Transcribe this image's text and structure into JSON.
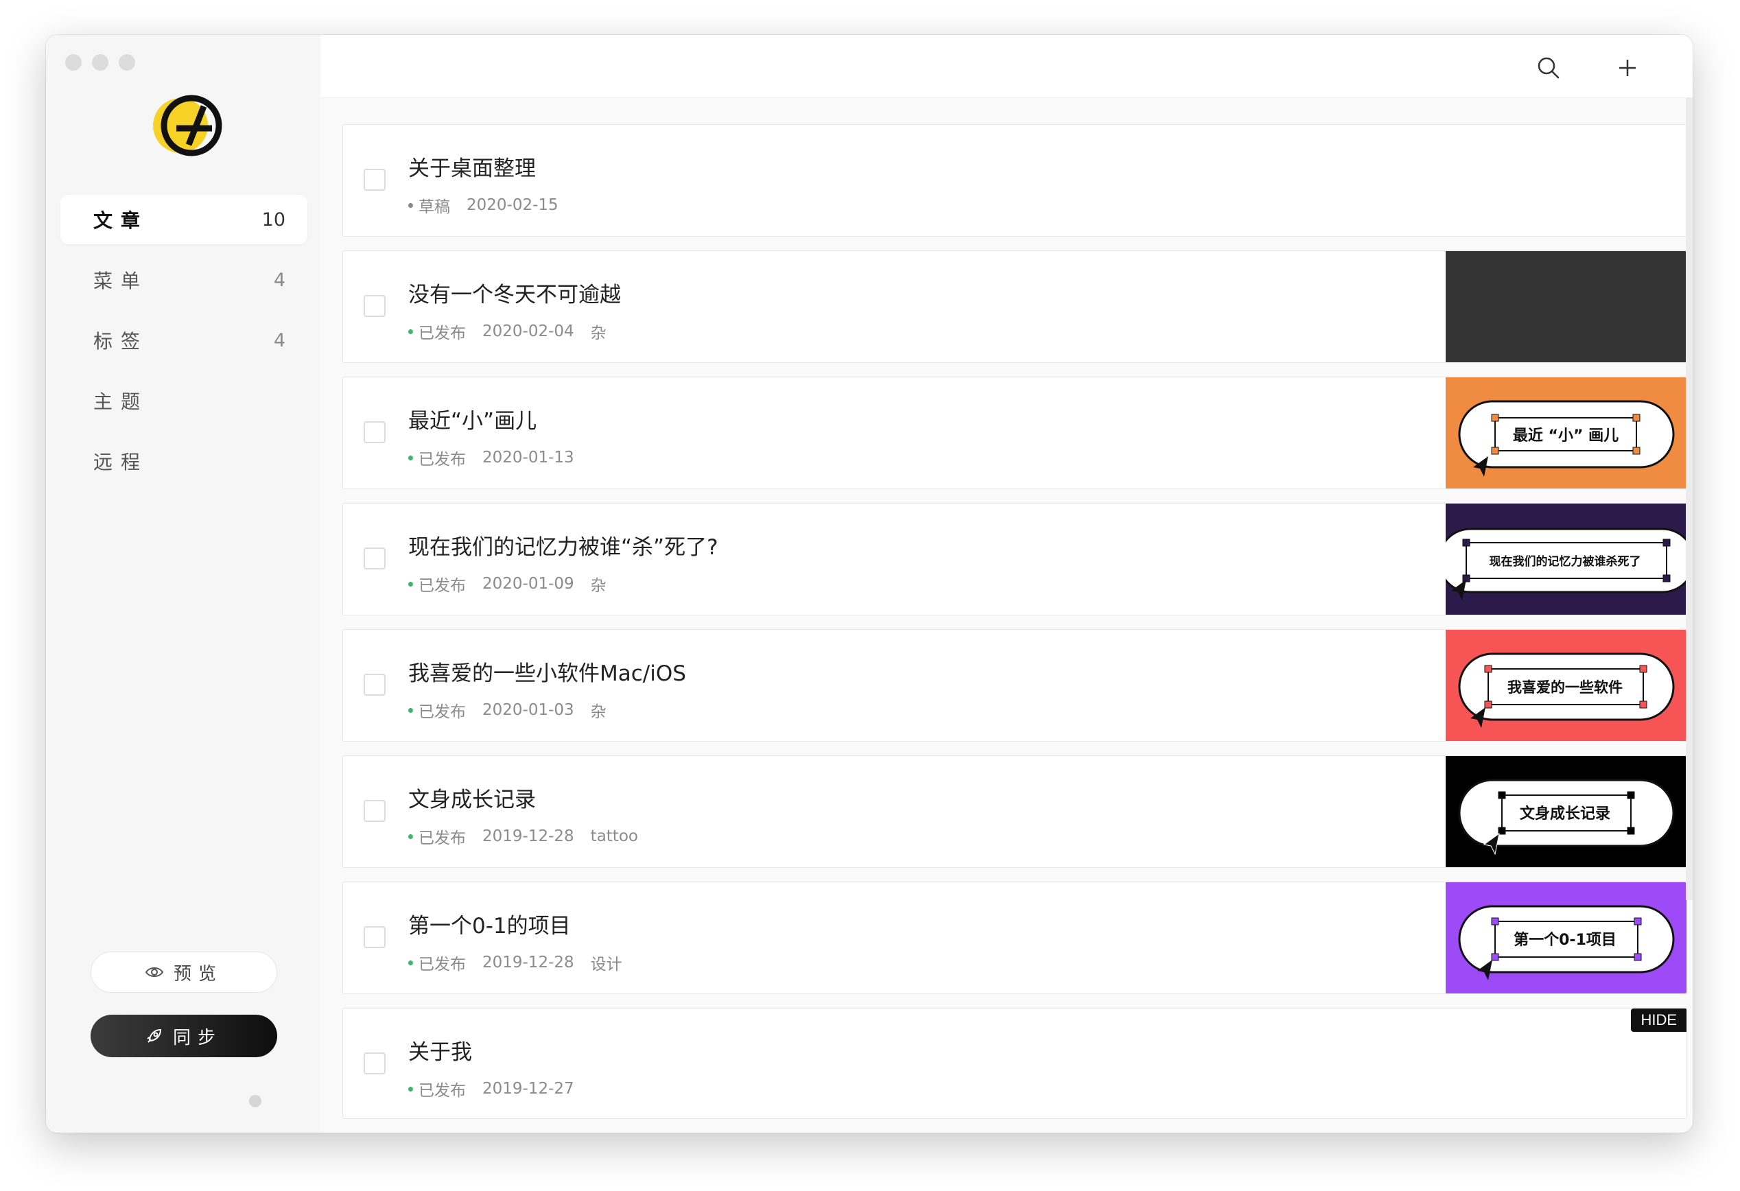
{
  "sidebar": {
    "nav": [
      {
        "label": "文章",
        "count": "10"
      },
      {
        "label": "菜单",
        "count": "4"
      },
      {
        "label": "标签",
        "count": "4"
      },
      {
        "label": "主题",
        "count": ""
      },
      {
        "label": "远程",
        "count": ""
      }
    ],
    "preview_label": "预览",
    "sync_label": "同步"
  },
  "colors": {
    "logo_yellow": "#F7D226",
    "published_dot": "#3CB371",
    "draft_dot": "#888888",
    "thumb_dark": "#343434",
    "thumb_orange": "#EF8C41",
    "thumb_purple_dark": "#2B1A4A",
    "thumb_red": "#F75555",
    "thumb_black": "#000000",
    "thumb_violet": "#9C4BF7"
  },
  "posts": [
    {
      "title": "关于桌面整理",
      "status": "草稿",
      "date": "2020-02-15",
      "tag": "",
      "thumb": ""
    },
    {
      "title": "没有一个冬天不可逾越",
      "status": "已发布",
      "date": "2020-02-04",
      "tag": "杂",
      "thumb": "dark"
    },
    {
      "title": "最近“小”画儿",
      "status": "已发布",
      "date": "2020-01-13",
      "tag": "",
      "thumb": "orange",
      "thumb_text": "最近 “小” 画儿"
    },
    {
      "title": "现在我们的记忆力被谁“杀”死了?",
      "status": "已发布",
      "date": "2020-01-09",
      "tag": "杂",
      "thumb": "purple-dark",
      "thumb_text": "现在我们的记忆力被谁杀死了"
    },
    {
      "title": "我喜爱的一些小软件Mac/iOS",
      "status": "已发布",
      "date": "2020-01-03",
      "tag": "杂",
      "thumb": "red",
      "thumb_text": "我喜爱的一些软件"
    },
    {
      "title": "文身成长记录",
      "status": "已发布",
      "date": "2019-12-28",
      "tag": "tattoo",
      "thumb": "black",
      "thumb_text": "文身成长记录"
    },
    {
      "title": "第一个0-1的项目",
      "status": "已发布",
      "date": "2019-12-28",
      "tag": "设计",
      "thumb": "violet",
      "thumb_text": "第一个0-1项目"
    },
    {
      "title": "关于我",
      "status": "已发布",
      "date": "2019-12-27",
      "tag": "",
      "thumb": "",
      "badge": "HIDE"
    }
  ]
}
